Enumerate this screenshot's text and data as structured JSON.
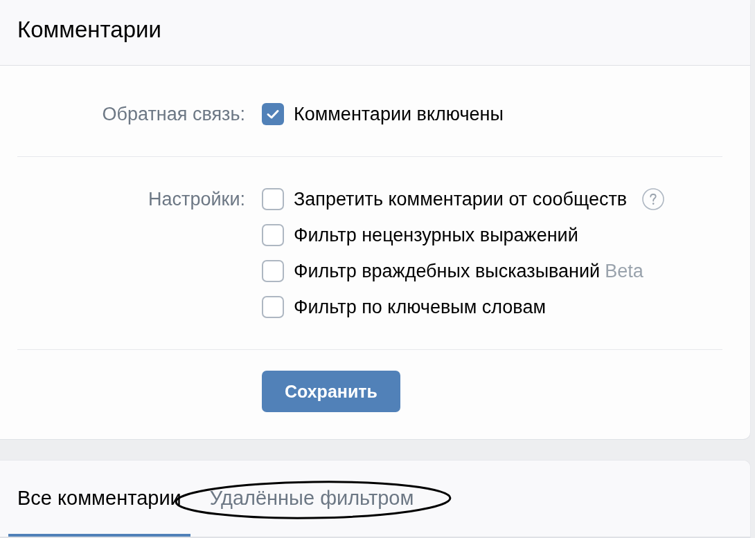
{
  "section": {
    "title": "Комментарии"
  },
  "feedback": {
    "label": "Обратная связь:",
    "option": {
      "label": "Комментарии включены",
      "checked": true
    }
  },
  "settings": {
    "label": "Настройки:",
    "options": [
      {
        "label": "Запретить комментарии от сообществ",
        "checked": false,
        "help": true
      },
      {
        "label": "Фильтр нецензурных выражений",
        "checked": false,
        "help": false
      },
      {
        "label": "Фильтр враждебных высказываний",
        "badge": "Beta",
        "checked": false,
        "help": false
      },
      {
        "label": "Фильтр по ключевым словам",
        "checked": false,
        "help": false
      }
    ]
  },
  "save_button": "Сохранить",
  "comment_tabs": [
    {
      "label": "Все комментарии",
      "selected": true,
      "circled": false
    },
    {
      "label": "Удалённые фильтром",
      "selected": false,
      "circled": true
    }
  ]
}
